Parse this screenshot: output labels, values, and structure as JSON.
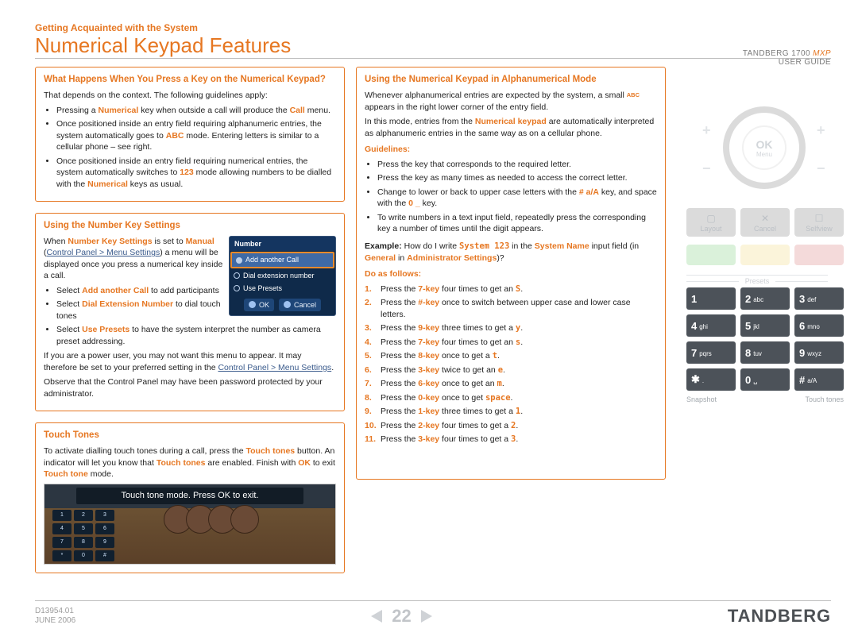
{
  "header": {
    "eyebrow": "Getting Acquainted with the System",
    "title": "Numerical Keypad Features",
    "product": "TANDBERG 1700",
    "product_suffix": "MXP",
    "doc_label": "USER GUIDE"
  },
  "box_press": {
    "heading": "What Happens When You Press a Key on the Numerical Keypad?",
    "intro": "That depends on the context. The following guidelines apply:",
    "b1_a": "Pressing a ",
    "b1_num": "Numerical",
    "b1_b": " key when outside a call will produce the ",
    "b1_call": "Call",
    "b1_c": " menu.",
    "b2_a": "Once positioned inside an entry field requiring alphanumeric entries, the system automatically goes to ",
    "b2_abc": "ABC",
    "b2_b": " mode. Entering letters is similar to a cellular phone – see right.",
    "b3_a": "Once positioned inside an entry field requiring numerical entries, the system automatically switches to ",
    "b3_123": "123",
    "b3_b": " mode allowing numbers to be dialled with the ",
    "b3_num": "Numerical",
    "b3_c": " keys as usual."
  },
  "box_numkey": {
    "heading": "Using the Number Key Settings",
    "p1_a": "When ",
    "p1_nks": "Number Key Settings",
    "p1_b": " is set to ",
    "p1_manual": "Manual",
    "p1_c": " (",
    "p1_link": "Control Panel > Menu Settings",
    "p1_d": ") a menu will be displayed once you press a numerical key inside a call.",
    "li1_a": "Select ",
    "li1_add": "Add another Call",
    "li1_b": " to add participants",
    "li2_a": "Select ",
    "li2_dial": "Dial Extension Number",
    "li2_b": " to dial touch tones",
    "li3_a": "Select ",
    "li3_use": "Use Presets",
    "li3_b": " to have the system interpret the number as camera preset addressing.",
    "p2_a": "If you are a power user, you may not want this menu to appear. It may therefore be set to your preferred setting in the ",
    "p2_link": "Control Panel > Menu Settings",
    "p2_b": ".",
    "p3": "Observe that the Control Panel may have been password protected by your administrator.",
    "dialog": {
      "title": "Number",
      "opt1": "Add another Call",
      "opt2": "Dial extension number",
      "opt3": "Use Presets",
      "ok": "OK",
      "cancel": "Cancel"
    }
  },
  "box_touch": {
    "heading": "Touch Tones",
    "p_a": "To activate dialling touch tones during a call, press the ",
    "p_tt": "Touch tones",
    "p_b": " button. An indicator will let you know that ",
    "p_tt2": "Touch tones",
    "p_c": " are enabled. Finish with ",
    "p_ok": "OK",
    "p_d": " to exit ",
    "p_ttm": "Touch tone",
    "p_e": " mode.",
    "banner": "Touch tone mode. Press OK to exit."
  },
  "box_alpha": {
    "heading": "Using the Numerical Keypad in Alphanumerical Mode",
    "p1_a": "Whenever alphanumerical entries are expected by the system, a small ",
    "p1_abc": "ABC",
    "p1_b": " appears in the right lower corner of the entry field.",
    "p2_a": "In this mode, entries from the ",
    "p2_nk": "Numerical keypad",
    "p2_b": " are automatically interpreted as alphanumeric entries in the same way as on a cellular phone.",
    "guidelines": "Guidelines:",
    "g1": "Press the key that corresponds to the required letter.",
    "g2": "Press the key as many times as needed to access the correct letter.",
    "g3_a": "Change to lower or back to upper case letters with the ",
    "g3_hash": "# a/A",
    "g3_b": " key, and space with the ",
    "g3_zero": "0 _",
    "g3_c": " key.",
    "g4": "To write numbers in a text input field, repeatedly press the corresponding key a number of times until the digit appears.",
    "ex_lead": "Example:",
    "ex_a": " How do I write ",
    "ex_sys": "System 123",
    "ex_b": " in the ",
    "ex_sn": "System Name",
    "ex_c": " input field (in ",
    "ex_gen": "General",
    "ex_d": " in ",
    "ex_adm": "Administrator Settings",
    "ex_e": ")?",
    "do": "Do as follows:",
    "steps": {
      "s1_a": "Press the ",
      "s1_k": "7-key",
      "s1_b": " four times to get an ",
      "s1_r": "S",
      "s1_c": ".",
      "s2_a": "Press the ",
      "s2_k": "#-key",
      "s2_b": " once to switch between upper case and lower case letters.",
      "s3_a": "Press the ",
      "s3_k": "9-key",
      "s3_b": " three times to get a ",
      "s3_r": "y",
      "s3_c": ".",
      "s4_a": "Press the ",
      "s4_k": "7-key",
      "s4_b": " four times to get an ",
      "s4_r": "s",
      "s4_c": ".",
      "s5_a": "Press the ",
      "s5_k": "8-key",
      "s5_b": " once to get a ",
      "s5_r": "t",
      "s5_c": ".",
      "s6_a": "Press the ",
      "s6_k": "3-key",
      "s6_b": " twice to get an ",
      "s6_r": "e",
      "s6_c": ".",
      "s7_a": "Press the ",
      "s7_k": "6-key",
      "s7_b": " once to get an ",
      "s7_r": "m",
      "s7_c": ".",
      "s8_a": "Press the ",
      "s8_k": "0-key",
      "s8_b": " once to get ",
      "s8_r": "space",
      "s8_c": ".",
      "s9_a": "Press the ",
      "s9_k": "1-key",
      "s9_b": " three times to get a ",
      "s9_r": "1",
      "s9_c": ".",
      "s10_a": "Press the ",
      "s10_k": "2-key",
      "s10_b": " four times to get a ",
      "s10_r": "2",
      "s10_c": ".",
      "s11_a": "Press the ",
      "s11_k": "3-key",
      "s11_b": " four times to get a ",
      "s11_r": "3",
      "s11_c": "."
    }
  },
  "remote": {
    "ok": "OK",
    "menu": "Menu",
    "soft1": "Layout",
    "soft2": "Cancel",
    "soft3": "Selfview",
    "presets": "Presets",
    "keys": {
      "k1": "1",
      "k1s": "",
      "k2": "2",
      "k2s": "abc",
      "k3": "3",
      "k3s": "def",
      "k4": "4",
      "k4s": "ghi",
      "k5": "5",
      "k5s": "jkl",
      "k6": "6",
      "k6s": "mno",
      "k7": "7",
      "k7s": "pqrs",
      "k8": "8",
      "k8s": "tuv",
      "k9": "9",
      "k9s": "wxyz",
      "kst": "✱",
      "ksts": ".",
      "k0": "0",
      "k0s": "␣",
      "kh": "#",
      "khs": "a/A"
    },
    "snapshot": "Snapshot",
    "touchtones": "Touch tones"
  },
  "footer": {
    "docid": "D13954.01",
    "date": "JUNE 2006",
    "page": "22",
    "brand": "TANDBERG"
  }
}
